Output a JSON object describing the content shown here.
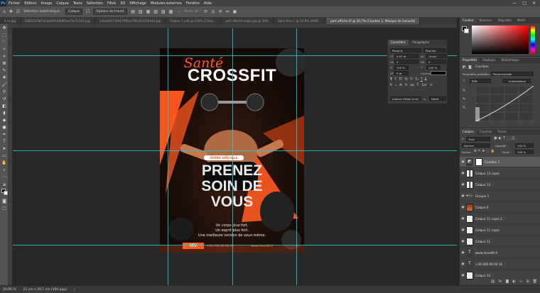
{
  "menu": {
    "logo": "Ps",
    "items": [
      "Fichier",
      "Edition",
      "Image",
      "Calque",
      "Texte",
      "Sélection",
      "Filtre",
      "3D",
      "Affichage",
      "Modules externes",
      "Fenêtre",
      "Aide"
    ],
    "win_min": "—",
    "win_max": "□",
    "win_close": "✕"
  },
  "options": {
    "autoselect": "Sélection automatique :",
    "autoselect_value": "Calque",
    "transform": "Options de transf.",
    "mode3d": "Mode 3D :"
  },
  "tabs": [
    {
      "label": "ll-rd.jpg",
      "active": false
    },
    {
      "label": "6483337b87b3ab69c58d95ea7bc7c162.jpg",
      "active": false
    },
    {
      "label": "23ecb047449179f6ac79fca54530e44.jpg",
      "active": false
    },
    {
      "label": "Calque 1.psb @ 100% (Calqu...",
      "active": false
    },
    {
      "label": "port affiche copie.jpg @ 20%",
      "active": false
    },
    {
      "label": "Sans titre-1 @ 23,9% (RVB/...",
      "active": false
    },
    {
      "label": "port affiche.tif @ 20,7% (Courbes 1, Masque de fusion/8)",
      "active": true
    }
  ],
  "poster": {
    "script_title": "Santé",
    "main_title": "CROSSFIT",
    "badge": "OFFRE SPÉCIALE",
    "headline": [
      "PRENEZ",
      "SOIN DE",
      "VOUS"
    ],
    "tagline": [
      "Un corps plus fort.",
      "Un esprit plus fort.",
      "Une meilleure version de vous-même."
    ],
    "logo_letters": "MV",
    "phone": "+34 000 00 00 10",
    "website": "www.movefit.fr"
  },
  "status": {
    "zoom": "20,66 %",
    "doc_size": "21 cm x 29,7 cm (300 ppp)"
  },
  "character_panel": {
    "tabs": [
      "Caractère",
      "Paragraphe"
    ],
    "font_family": "Poppins",
    "font_style": "Regular",
    "font_size": "4,92 pt",
    "leading": "(Auto)",
    "kerning": "0",
    "tracking": "0",
    "vscale": "100 %",
    "hscale": "100 %",
    "baseline": "0 pt",
    "color_label": "Couleur :",
    "style_buttons": [
      "T",
      "T",
      "TT",
      "Tt",
      "T¹",
      "T₁",
      "T",
      "T"
    ],
    "opentype_buttons": [
      "fi",
      "ℴ",
      "st",
      "A",
      "aa",
      "T",
      "1st",
      "½"
    ],
    "language": "Anglais (Etats-Unis)",
    "aa_label": "aₐ",
    "antialias": "Nette"
  },
  "color_panel": {
    "tabs": [
      "Couleur",
      "Nuancier",
      "Dégradés",
      "Motifs"
    ]
  },
  "properties_panel": {
    "tabs": [
      "Propriétés",
      "Réglages",
      "Bibliothèque"
    ],
    "type": "Courbes",
    "preset_label": "Paramètre prédéfini :",
    "preset_value": "Personnalisée",
    "channel": "RVB",
    "auto": "Automatique"
  },
  "layers_panel": {
    "tabs": [
      "Calques",
      "Couches",
      "Tracés"
    ],
    "filter": "Type",
    "blend_mode": "Normal",
    "opacity_label": "Opacité :",
    "opacity": "100 %",
    "lock_label": "Verrou :",
    "fill_label": "Fond :",
    "fill": "100 %",
    "layers": [
      {
        "name": "Courbes 1",
        "kind": "adjust",
        "selected": true
      },
      {
        "name": "Calque 13 copie",
        "kind": "dark",
        "selected": false
      },
      {
        "name": "Calque 13",
        "kind": "dark",
        "selected": false
      },
      {
        "name": "Groupe 1",
        "kind": "folder",
        "selected": false
      },
      {
        "name": "Calque 0",
        "kind": "photo",
        "selected": false
      },
      {
        "name": "Calque 11 copie 2",
        "kind": "raster",
        "selected": false
      },
      {
        "name": "Calque 11 copie",
        "kind": "raster",
        "selected": false
      },
      {
        "name": "Calque 11",
        "kind": "raster",
        "selected": false
      },
      {
        "name": "www.movefit.fr",
        "kind": "text",
        "selected": false
      },
      {
        "name": "+34 000 00 00 10",
        "kind": "text",
        "selected": false
      },
      {
        "name": "Calque 10",
        "kind": "raster",
        "selected": false
      }
    ]
  },
  "colors": {
    "accent": "#ff5a1f",
    "guide": "#2fc6c6",
    "panel_bg": "#424242",
    "workspace": "#282828"
  }
}
